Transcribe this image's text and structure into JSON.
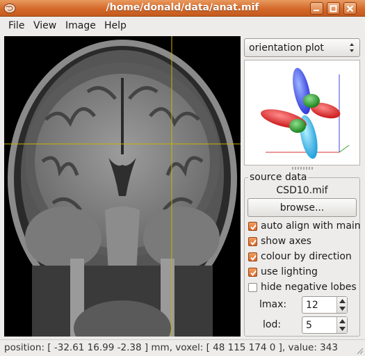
{
  "window": {
    "title": "/home/donald/data/anat.mif"
  },
  "menu": [
    "File",
    "View",
    "Image",
    "Help"
  ],
  "tool_selector": {
    "value": "orientation plot"
  },
  "source_data": {
    "title": "source data",
    "file": "CSD10.mif",
    "browse_label": "browse..."
  },
  "options": [
    {
      "label": "auto align with main",
      "checked": true
    },
    {
      "label": "show axes",
      "checked": true
    },
    {
      "label": "colour by direction",
      "checked": true
    },
    {
      "label": "use lighting",
      "checked": true
    },
    {
      "label": "hide negative lobes",
      "checked": false
    }
  ],
  "lmax": {
    "label": "lmax:",
    "value": "12"
  },
  "lod": {
    "label": "lod:",
    "value": "5"
  },
  "status": "position: [ -32.61 16.99 -2.38 ] mm, voxel: [ 48 115 174 0 ], value: 343",
  "colors": {
    "accent": "#d4692a",
    "crosshair": "#c8b400"
  }
}
